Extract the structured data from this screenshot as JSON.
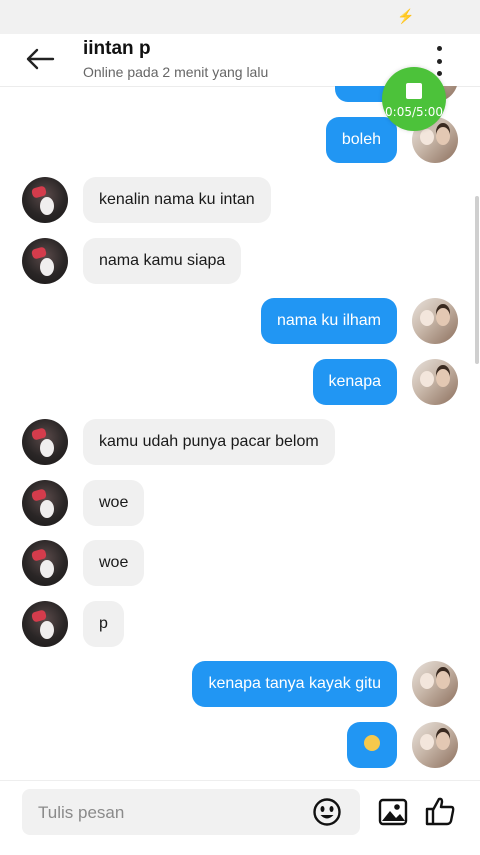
{
  "status_bar": {
    "icon": "bolt-icon"
  },
  "header": {
    "title": "iintan p",
    "subtitle": "Online pada 2 menit yang lalu"
  },
  "recorder": {
    "time": "0:05/5:00"
  },
  "messages": [
    {
      "from": "me",
      "text": ""
    },
    {
      "from": "me",
      "text": "boleh"
    },
    {
      "from": "them",
      "text": "kenalin nama ku intan"
    },
    {
      "from": "them",
      "text": "nama kamu siapa"
    },
    {
      "from": "me",
      "text": "nama ku ilham"
    },
    {
      "from": "me",
      "text": "kenapa"
    },
    {
      "from": "them",
      "text": "kamu udah punya pacar belom"
    },
    {
      "from": "them",
      "text": "woe"
    },
    {
      "from": "them",
      "text": "woe"
    },
    {
      "from": "them",
      "text": "p"
    },
    {
      "from": "me",
      "text": "kenapa tanya kayak gitu"
    },
    {
      "from": "me",
      "text": "",
      "emoji": "neutral-face-emoji"
    }
  ],
  "composer": {
    "placeholder": "Tulis pesan"
  },
  "colors": {
    "outgoing": "#2196f3",
    "incoming": "#f0f0f0",
    "recorder": "#4cc23a"
  }
}
